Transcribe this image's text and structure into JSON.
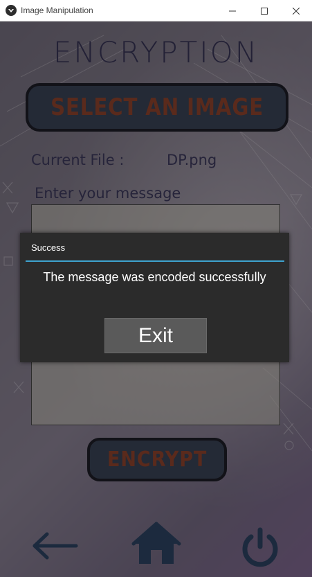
{
  "window": {
    "title": "Image Manipulation",
    "controls": {
      "minimize_icon": "minimize-icon",
      "maximize_icon": "maximize-icon",
      "close_icon": "close-icon"
    }
  },
  "screen": {
    "heading": "ENCRYPTION",
    "select_button_label": "SELECT AN IMAGE",
    "current_file_label": "Current File :",
    "current_file_value": "DP.png",
    "message_label": "Enter your message",
    "message_value": "",
    "encrypt_button_label": "ENCRYPT"
  },
  "bottom_nav": {
    "back_icon": "back-arrow-icon",
    "home_icon": "home-icon",
    "power_icon": "power-icon"
  },
  "popup": {
    "title": "Success",
    "message": "The message was encoded successfully",
    "exit_label": "Exit"
  },
  "colors": {
    "accent_line": "#3ea3d0",
    "popup_bg": "#2b2b2b",
    "button_text": "#5a2a1c",
    "nav_icon": "#1c2a3e"
  }
}
